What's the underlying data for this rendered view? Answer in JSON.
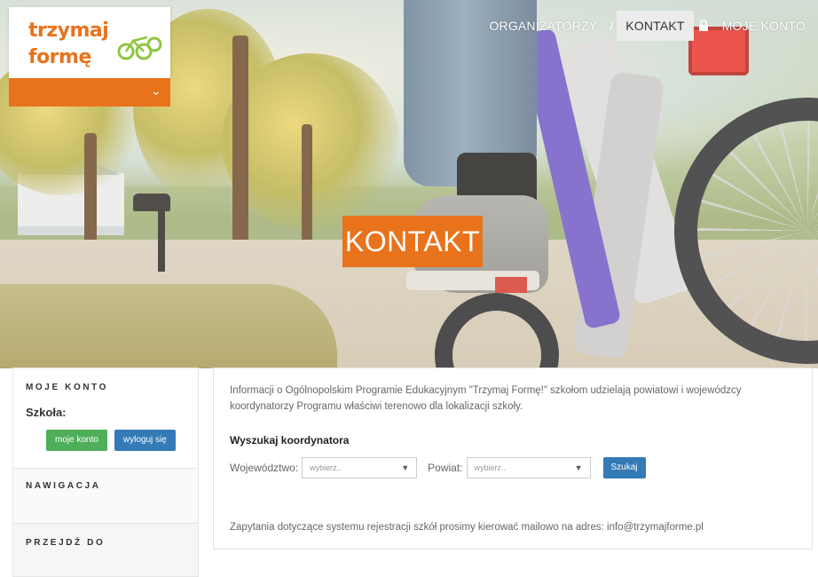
{
  "logo": {
    "line1": "trzymaj",
    "line2": "formę"
  },
  "nav": {
    "items": [
      {
        "label": "ORGANIZATORZY"
      },
      {
        "label": "KONTAKT"
      },
      {
        "label": "MOJE KONTO"
      }
    ],
    "separator": "/"
  },
  "hero": {
    "title": "KONTAKT"
  },
  "sidebar": {
    "account": {
      "heading": "MOJE KONTO",
      "school_label": "Szkoła:",
      "buttons": {
        "account": "moje konto",
        "logout": "wyloguj się"
      }
    },
    "navigation": {
      "heading": "NAWIGACJA"
    },
    "goto": {
      "heading": "PRZEJDŹ DO"
    }
  },
  "main": {
    "intro": "Informacji o Ogólnopolskim Programie Edukacyjnym \"Trzymaj Formę!\" szkołom udzielają powiatowi i wojewódzcy koordynatorzy Programu właściwi terenowo dla lokalizacji szkoły.",
    "search_title": "Wyszukaj koordynatora",
    "voivodeship_label": "Województwo:",
    "voivodeship_value": "wybierz..",
    "county_label": "Powiat:",
    "county_value": "wybierz..",
    "search_button": "Szukaj",
    "footer_note": "Zapytania dotyczące systemu rejestracji szkół prosimy kierować mailowo na adres: info@trzymajforme.pl"
  },
  "colors": {
    "accent": "#e8731c",
    "green": "#4fae5a",
    "blue": "#347ab7"
  }
}
